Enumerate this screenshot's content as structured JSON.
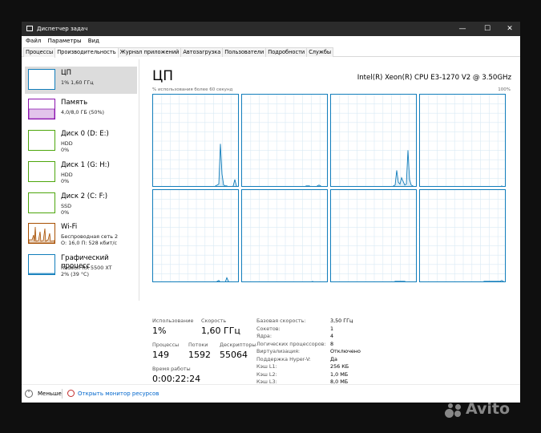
{
  "window": {
    "title": "Диспетчер задач",
    "minimize": "—",
    "maximize": "☐",
    "close": "✕"
  },
  "menu": [
    "Файл",
    "Параметры",
    "Вид"
  ],
  "tabs": [
    "Процессы",
    "Производительность",
    "Журнал приложений",
    "Автозагрузка",
    "Пользователи",
    "Подробности",
    "Службы"
  ],
  "active_tab": 1,
  "sidebar": [
    {
      "name": "ЦП",
      "line1": "1% 1,60 ГГц",
      "line2": "",
      "color": "#117dbb",
      "selected": true
    },
    {
      "name": "Память",
      "line1": "4,0/8,0 ГБ (50%)",
      "line2": "",
      "color": "#8b12ae",
      "selected": false
    },
    {
      "name": "Диск 0 (D: E:)",
      "line1": "HDD",
      "line2": "0%",
      "color": "#4da60c",
      "selected": false
    },
    {
      "name": "Диск 1 (G: H:)",
      "line1": "HDD",
      "line2": "0%",
      "color": "#4da60c",
      "selected": false
    },
    {
      "name": "Диск 2 (C: F:)",
      "line1": "SSD",
      "line2": "0%",
      "color": "#4da60c",
      "selected": false
    },
    {
      "name": "Wi-Fi",
      "line1": "Беспроводная сеть 2",
      "line2": "О: 16,0 П: 528 кбит/с",
      "color": "#a74f01",
      "selected": false
    },
    {
      "name": "Графический процесс",
      "line1": "Radeon RX 5500 XT",
      "line2": "2% (39 °C)",
      "color": "#117dbb",
      "selected": false
    }
  ],
  "main": {
    "heading": "ЦП",
    "cpu_model": "Intel(R) Xeon(R) CPU E3-1270 V2 @ 3.50GHz",
    "graph_caption": "% использования более 60 секунд",
    "graph_max": "100%",
    "graph_color": "#117dbb",
    "core_usage": [
      [
        0,
        0,
        0,
        0,
        0,
        0,
        0,
        0,
        0,
        0,
        0,
        0,
        0,
        0,
        0,
        0,
        0,
        0,
        0,
        0,
        0,
        0,
        0,
        0,
        0,
        0,
        0,
        0,
        0,
        0,
        0,
        0,
        0,
        0,
        0,
        0,
        0,
        0,
        0,
        1,
        2,
        3,
        47,
        14,
        2,
        1,
        1,
        0,
        0,
        0,
        1,
        8,
        1,
        0,
        0
      ],
      [
        0,
        0,
        0,
        0,
        0,
        0,
        0,
        0,
        0,
        0,
        0,
        0,
        0,
        0,
        0,
        0,
        0,
        0,
        0,
        0,
        0,
        0,
        0,
        0,
        0,
        0,
        0,
        0,
        0,
        0,
        0,
        0,
        0,
        0,
        0,
        0,
        0,
        0,
        0,
        0,
        1,
        1,
        1,
        0,
        0,
        0,
        0,
        1,
        2,
        1,
        0,
        0,
        0,
        0,
        0
      ],
      [
        0,
        0,
        0,
        0,
        0,
        0,
        0,
        0,
        0,
        0,
        0,
        0,
        0,
        0,
        0,
        0,
        0,
        0,
        0,
        0,
        0,
        0,
        0,
        0,
        0,
        0,
        0,
        0,
        0,
        0,
        0,
        0,
        0,
        0,
        0,
        0,
        0,
        0,
        0,
        1,
        2,
        18,
        5,
        3,
        10,
        6,
        2,
        3,
        40,
        8,
        2,
        1,
        0,
        0,
        0
      ],
      [
        0,
        0,
        0,
        0,
        0,
        0,
        0,
        0,
        0,
        0,
        0,
        0,
        0,
        0,
        0,
        0,
        0,
        0,
        0,
        0,
        0,
        0,
        0,
        0,
        0,
        0,
        0,
        0,
        0,
        0,
        0,
        0,
        0,
        0,
        0,
        0,
        0,
        0,
        0,
        0,
        0,
        0,
        0,
        0,
        0,
        0,
        0,
        0,
        0,
        0,
        0,
        1,
        0,
        0,
        0
      ],
      [
        0,
        0,
        0,
        0,
        0,
        0,
        0,
        0,
        0,
        0,
        0,
        0,
        0,
        0,
        0,
        0,
        0,
        0,
        0,
        0,
        0,
        0,
        0,
        0,
        0,
        0,
        0,
        0,
        0,
        0,
        0,
        0,
        0,
        0,
        0,
        0,
        0,
        0,
        0,
        0,
        1,
        2,
        0,
        0,
        0,
        0,
        5,
        1,
        0,
        0,
        0,
        0,
        0,
        0,
        0
      ],
      [
        0,
        0,
        0,
        0,
        0,
        0,
        0,
        0,
        0,
        0,
        0,
        0,
        0,
        0,
        0,
        0,
        0,
        0,
        0,
        0,
        0,
        0,
        0,
        0,
        0,
        0,
        0,
        0,
        0,
        0,
        0,
        0,
        0,
        0,
        0,
        0,
        0,
        0,
        0,
        0,
        0,
        0,
        0,
        0,
        1,
        0,
        0,
        0,
        0,
        0,
        0,
        0,
        0,
        0,
        0
      ],
      [
        0,
        0,
        0,
        0,
        0,
        0,
        0,
        0,
        0,
        0,
        0,
        0,
        0,
        0,
        0,
        0,
        0,
        0,
        0,
        0,
        0,
        0,
        0,
        0,
        0,
        0,
        0,
        0,
        0,
        0,
        0,
        0,
        0,
        0,
        0,
        0,
        0,
        0,
        0,
        0,
        1,
        1,
        1,
        1,
        1,
        1,
        1,
        0,
        0,
        0,
        0,
        0,
        0,
        0,
        0
      ],
      [
        0,
        0,
        0,
        0,
        0,
        0,
        0,
        0,
        0,
        0,
        0,
        0,
        0,
        0,
        0,
        0,
        0,
        0,
        0,
        0,
        0,
        0,
        0,
        0,
        0,
        0,
        0,
        0,
        0,
        0,
        0,
        0,
        0,
        0,
        0,
        0,
        0,
        0,
        0,
        0,
        1,
        1,
        1,
        1,
        1,
        1,
        1,
        1,
        1,
        1,
        1,
        2,
        1,
        0,
        0
      ]
    ]
  },
  "stats": {
    "usage_label": "Использование",
    "usage_value": "1%",
    "speed_label": "Скорость",
    "speed_value": "1,60 ГГц",
    "processes_label": "Процессы",
    "processes_value": "149",
    "threads_label": "Потоки",
    "threads_value": "1592",
    "handles_label": "Дескрипторы",
    "handles_value": "55064",
    "uptime_label": "Время работы",
    "uptime_value": "0:00:22:24"
  },
  "specs": [
    {
      "key": "Базовая скорость:",
      "value": "3,50 ГГц"
    },
    {
      "key": "Сокетов:",
      "value": "1"
    },
    {
      "key": "Ядра:",
      "value": "4"
    },
    {
      "key": "Логических процессоров:",
      "value": "8"
    },
    {
      "key": "Виртуализация:",
      "value": "Отключено"
    },
    {
      "key": "Поддержка Hyper-V:",
      "value": "Да"
    },
    {
      "key": "Кэш L1:",
      "value": "256 КБ"
    },
    {
      "key": "Кэш L2:",
      "value": "1,0 МБ"
    },
    {
      "key": "Кэш L3:",
      "value": "8,0 МБ"
    }
  ],
  "footer": {
    "less": "Меньше",
    "monitor": "Открыть монитор ресурсов"
  },
  "watermark": "Avito"
}
